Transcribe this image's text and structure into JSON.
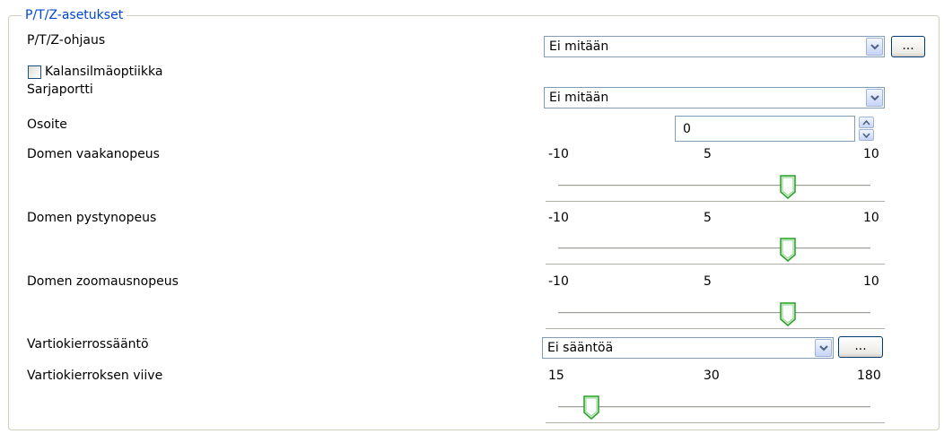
{
  "group_title": "P/T/Z-asetukset",
  "ptz_control": {
    "label": "P/T/Z-ohjaus",
    "value": "Ei mitään",
    "button_label": "..."
  },
  "fisheye": {
    "label": "Kalansilmäoptiikka",
    "checked": false
  },
  "serial_port": {
    "label": "Sarjaportti",
    "value": "Ei mitään"
  },
  "address": {
    "label": "Osoite",
    "value": "0"
  },
  "dome_pan_speed": {
    "label": "Domen vaakanopeus",
    "min": "-10",
    "mid": "5",
    "max": "10",
    "value": 5
  },
  "dome_tilt_speed": {
    "label": "Domen pystynopeus",
    "min": "-10",
    "mid": "5",
    "max": "10",
    "value": 5
  },
  "dome_zoom_speed": {
    "label": "Domen zoomausnopeus",
    "min": "-10",
    "mid": "5",
    "max": "10",
    "value": 5
  },
  "patrol_rule": {
    "label": "Vartiokierrossääntö",
    "value": "Ei sääntöä",
    "button_label": "..."
  },
  "patrol_delay": {
    "label": "Vartiokierroksen viive",
    "min": "15",
    "mid": "30",
    "max": "180",
    "value": 20
  },
  "colors": {
    "accent": "#0046d5",
    "thumb_green": "#21a121",
    "border": "#7f9db9"
  },
  "icons": [
    "chevron-down-icon",
    "spin-up-icon",
    "spin-down-icon",
    "slider-thumb-icon"
  ]
}
